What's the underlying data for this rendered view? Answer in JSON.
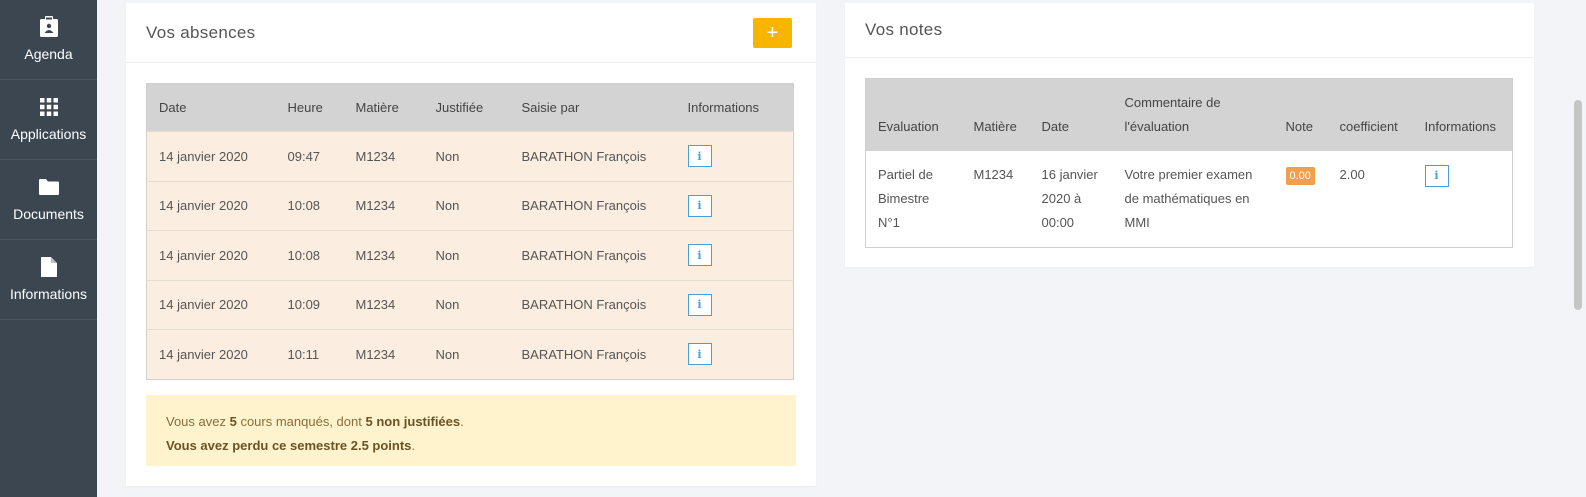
{
  "sidebar": {
    "items": [
      {
        "label": "Agenda",
        "icon": "calendar-icon"
      },
      {
        "label": "Applications",
        "icon": "grid-icon"
      },
      {
        "label": "Documents",
        "icon": "folder-icon"
      },
      {
        "label": "Informations",
        "icon": "document-icon"
      }
    ]
  },
  "absences": {
    "title": "Vos absences",
    "add_label": "+",
    "headers": [
      "Date",
      "Heure",
      "Matière",
      "Justifiée",
      "Saisie par",
      "Informations"
    ],
    "rows": [
      {
        "date": "14 janvier 2020",
        "heure": "09:47",
        "matiere": "M1234",
        "justifiee": "Non",
        "saisie": "BARATHON François",
        "info": "i"
      },
      {
        "date": "14 janvier 2020",
        "heure": "10:08",
        "matiere": "M1234",
        "justifiee": "Non",
        "saisie": "BARATHON François",
        "info": "i"
      },
      {
        "date": "14 janvier 2020",
        "heure": "10:08",
        "matiere": "M1234",
        "justifiee": "Non",
        "saisie": "BARATHON François",
        "info": "i"
      },
      {
        "date": "14 janvier 2020",
        "heure": "10:09",
        "matiere": "M1234",
        "justifiee": "Non",
        "saisie": "BARATHON François",
        "info": "i"
      },
      {
        "date": "14 janvier 2020",
        "heure": "10:11",
        "matiere": "M1234",
        "justifiee": "Non",
        "saisie": "BARATHON François",
        "info": "i"
      }
    ],
    "summary": {
      "line1_a": "Vous avez ",
      "count": "5",
      "line1_b": " cours manqués, dont ",
      "non_just": "5 non justifiées",
      "line1_c": ".",
      "line2": "Vous avez perdu ce semestre 2.5 points",
      "line2_end": "."
    }
  },
  "notes": {
    "title": "Vos notes",
    "headers": [
      "Evaluation",
      "Matière",
      "Date",
      "Commentaire de l'évaluation",
      "Note",
      "coefficient",
      "Informations"
    ],
    "rows": [
      {
        "evaluation": "Partiel de Bimestre N°1",
        "matiere": "M1234",
        "date": "16 janvier 2020 à 00:00",
        "commentaire": "Votre premier examen de mathématiques en MMI",
        "note": "0.00",
        "coefficient": "2.00",
        "info": "i"
      }
    ]
  },
  "colors": {
    "sidebar": "#3c4650",
    "accent": "#f7b500",
    "absence_row": "#fbeee0",
    "note_badge": "#f0a04b",
    "info_icon": "#4a9fd8"
  }
}
